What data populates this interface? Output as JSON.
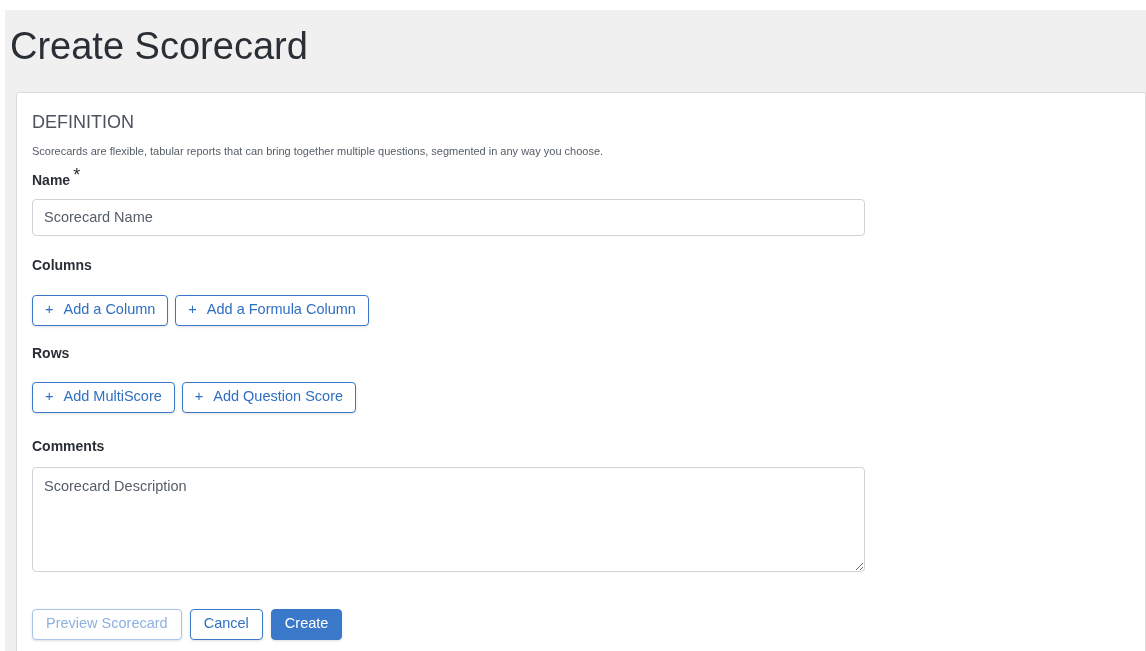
{
  "page": {
    "title": "Create Scorecard"
  },
  "section": {
    "heading": "DEFINITION",
    "description": "Scorecards are flexible, tabular reports that can bring together multiple questions, segmented in any way you choose."
  },
  "name_field": {
    "label": "Name",
    "required_mark": "*",
    "placeholder": "Scorecard Name"
  },
  "columns": {
    "label": "Columns",
    "buttons": [
      {
        "icon": "+",
        "label": "Add a Column"
      },
      {
        "icon": "+",
        "label": "Add a Formula Column"
      }
    ]
  },
  "rows": {
    "label": "Rows",
    "buttons": [
      {
        "icon": "+",
        "label": "Add MultiScore"
      },
      {
        "icon": "+",
        "label": "Add Question Score"
      }
    ]
  },
  "comments": {
    "label": "Comments",
    "placeholder": "Scorecard Description"
  },
  "actions": [
    {
      "label": "Preview Scorecard",
      "kind": "outline",
      "disabled": true
    },
    {
      "label": "Cancel",
      "kind": "outline",
      "disabled": false
    },
    {
      "label": "Create",
      "kind": "primary",
      "disabled": false
    }
  ]
}
